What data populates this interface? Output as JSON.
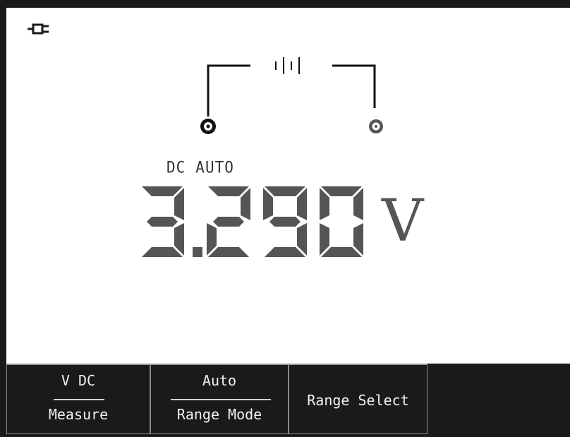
{
  "display": {
    "mode": "DC",
    "range": "AUTO",
    "reading": "3.290",
    "unit": "V"
  },
  "icons": {
    "power": "plug-power-icon",
    "battery": "battery-source-icon",
    "terminals": "probe-terminal-icon"
  },
  "softkeys": [
    {
      "value": "V DC",
      "label": "Measure"
    },
    {
      "value": "Auto",
      "label": "Range Mode"
    },
    {
      "label": "Range Select"
    }
  ],
  "colors": {
    "background": "#ffffff",
    "segments": "#555555",
    "softkey_bar": "#1a1a1a"
  }
}
